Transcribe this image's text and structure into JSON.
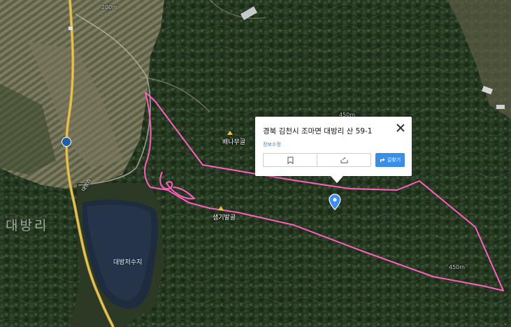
{
  "map": {
    "place_labels": [
      {
        "id": "baenamugol",
        "text": "배나무골"
      },
      {
        "id": "saemgisaetgol",
        "text": "샘기발골"
      },
      {
        "id": "reservoir",
        "text": "대방저수지"
      },
      {
        "id": "region",
        "text": "대방리"
      }
    ],
    "contour_labels": {
      "top": "200m",
      "mid": "450m",
      "bottom": "450m"
    },
    "road_label": "대방리",
    "route_color": "#ff5fc1"
  },
  "popup": {
    "address": "경북 김천시 조마면 대방리 산 59-1",
    "link": "정보수정",
    "route_button": "길찾기"
  },
  "icons": [
    "close-icon",
    "bookmark-icon",
    "share-icon",
    "directions-icon",
    "location-pin-icon"
  ]
}
